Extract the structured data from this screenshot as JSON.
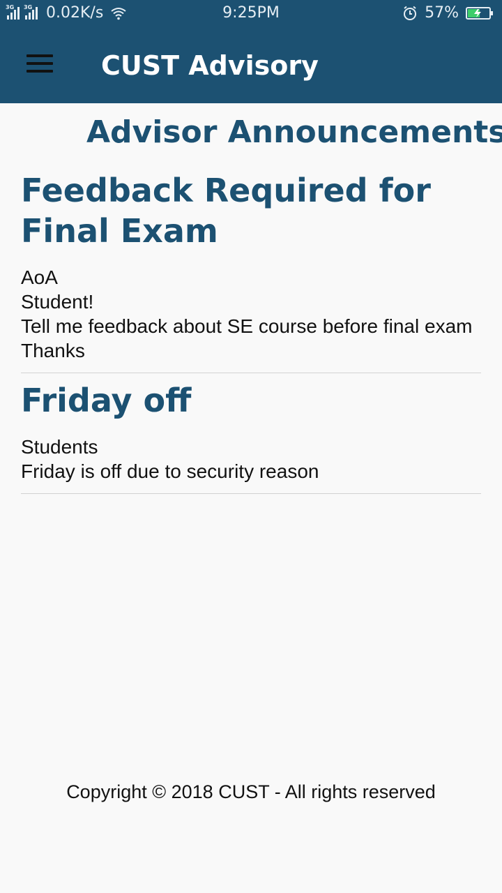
{
  "status_bar": {
    "network_label_1": "3G",
    "network_label_2": "3G",
    "speed": "0.02K/s",
    "time": "9:25PM",
    "battery": "57%",
    "battery_level": 0.57
  },
  "app_bar": {
    "title": "CUST Advisory",
    "menu_icon": "hamburger-menu-icon"
  },
  "page": {
    "heading": "Advisor Announcements"
  },
  "announcements": [
    {
      "title": "Feedback Required for Final Exam",
      "lines": [
        "AoA",
        "Student!",
        "Tell me feedback about SE course before final exam",
        "Thanks"
      ]
    },
    {
      "title": "Friday off",
      "lines": [
        "Students",
        "Friday is off due to security reason"
      ]
    }
  ],
  "footer": {
    "copyright": "Copyright © 2018 CUST - All rights reserved"
  },
  "colors": {
    "primary": "#1c5172",
    "background": "#f9f9f9",
    "battery_fill": "#3ccd6a"
  }
}
